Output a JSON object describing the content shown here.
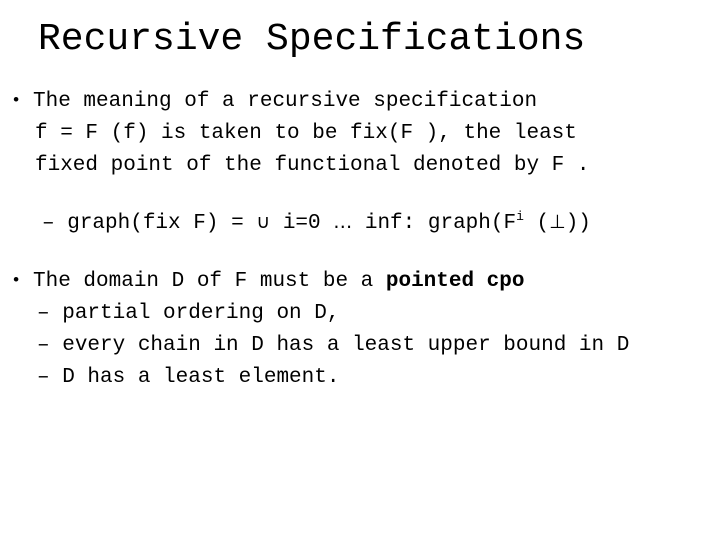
{
  "slide": {
    "title": "Recursive Specifications",
    "background_color": "#ffffff",
    "text_color": "#000000",
    "bullet_marker": "•",
    "dash_marker": "–",
    "bullets": [
      {
        "level": 1,
        "lines": [
          "The meaning of a recursive specification",
          "f = F (f) is taken to be fix(F ), the least",
          "fixed point of the functional denoted by F ."
        ]
      }
    ],
    "formula": {
      "dash": "–",
      "lhs": "graph(fix F)",
      "equals": "=",
      "union_symbol": "∪",
      "index": "i=0",
      "ellipsis": "…",
      "limit": "inf:",
      "rhs_prefix": "graph(F",
      "rhs_superscript": "i",
      "rhs_suffix": "(",
      "bottom_symbol": "⊥",
      "rhs_close": "))"
    },
    "bullet2": {
      "marker": "•",
      "text_plain": "The domain D of F must be a ",
      "text_bold": "pointed cpo"
    },
    "sub_bullets": [
      {
        "dash": "–",
        "text": "partial ordering on D,"
      },
      {
        "dash": "–",
        "text": "every chain in D has a least upper bound in D"
      },
      {
        "dash": "–",
        "text": "D has a least element."
      }
    ]
  }
}
